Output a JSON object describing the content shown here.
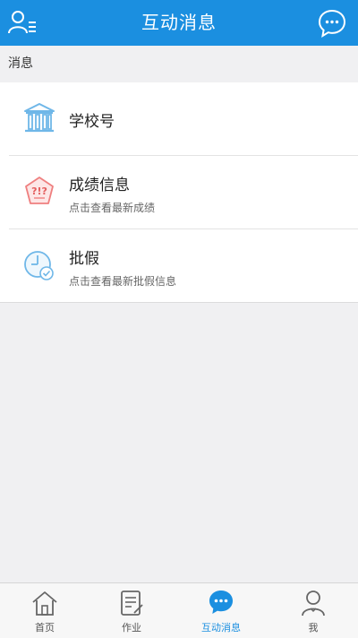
{
  "header": {
    "title": "互动消息",
    "left_icon": "user-menu-icon",
    "right_icon": "chat-bubble-icon",
    "bg_color": "#1b8fe0"
  },
  "section": {
    "label": "消息"
  },
  "messages": [
    {
      "title": "学校号",
      "subtitle": "",
      "icon": "school-building-icon"
    },
    {
      "title": "成绩信息",
      "subtitle": "点击查看最新成绩",
      "icon": "grade-badge-icon"
    },
    {
      "title": "批假",
      "subtitle": "点击查看最新批假信息",
      "icon": "clock-check-icon"
    }
  ],
  "tabbar": {
    "tabs": [
      {
        "label": "首页",
        "icon": "home-icon",
        "active": false
      },
      {
        "label": "作业",
        "icon": "homework-icon",
        "active": false
      },
      {
        "label": "互动消息",
        "icon": "message-icon",
        "active": true
      },
      {
        "label": "我",
        "icon": "profile-icon",
        "active": false
      }
    ],
    "active_color": "#1b8fe0"
  }
}
